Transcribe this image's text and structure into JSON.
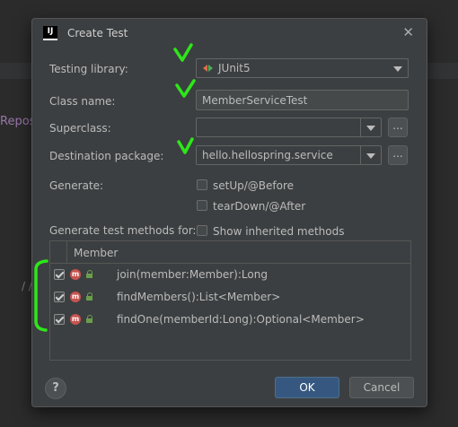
{
  "background": {
    "left_text": "Repos",
    "comment_text": "/ /"
  },
  "dialog": {
    "app_icon": "IJ",
    "title": "Create Test",
    "close_icon": "✕"
  },
  "form": {
    "testing_library_label": "Testing library:",
    "testing_library_value": "JUnit5",
    "class_name_label": "Class name:",
    "class_name_value": "MemberServiceTest",
    "superclass_label": "Superclass:",
    "superclass_value": "",
    "destination_label": "Destination package:",
    "destination_value": "hello.hellospring.service",
    "browse_label": "...",
    "generate_label": "Generate:",
    "setup_label": "setUp/@Before",
    "teardown_label": "tearDown/@After",
    "methods_label": "Generate test methods for:",
    "show_inherited_label": "Show inherited methods"
  },
  "table": {
    "header": "Member",
    "rows": [
      {
        "checked": true,
        "badge": "m",
        "name": "join(member:Member):Long"
      },
      {
        "checked": true,
        "badge": "m",
        "name": "findMembers():List<Member>"
      },
      {
        "checked": true,
        "badge": "m",
        "name": "findOne(memberId:Long):Optional<Member>"
      }
    ]
  },
  "footer": {
    "help_label": "?",
    "ok_label": "OK",
    "cancel_label": "Cancel"
  },
  "colors": {
    "annotation_green": "#2ee61a",
    "ok_button": "#365880",
    "dialog_bg": "#3c3f41"
  }
}
